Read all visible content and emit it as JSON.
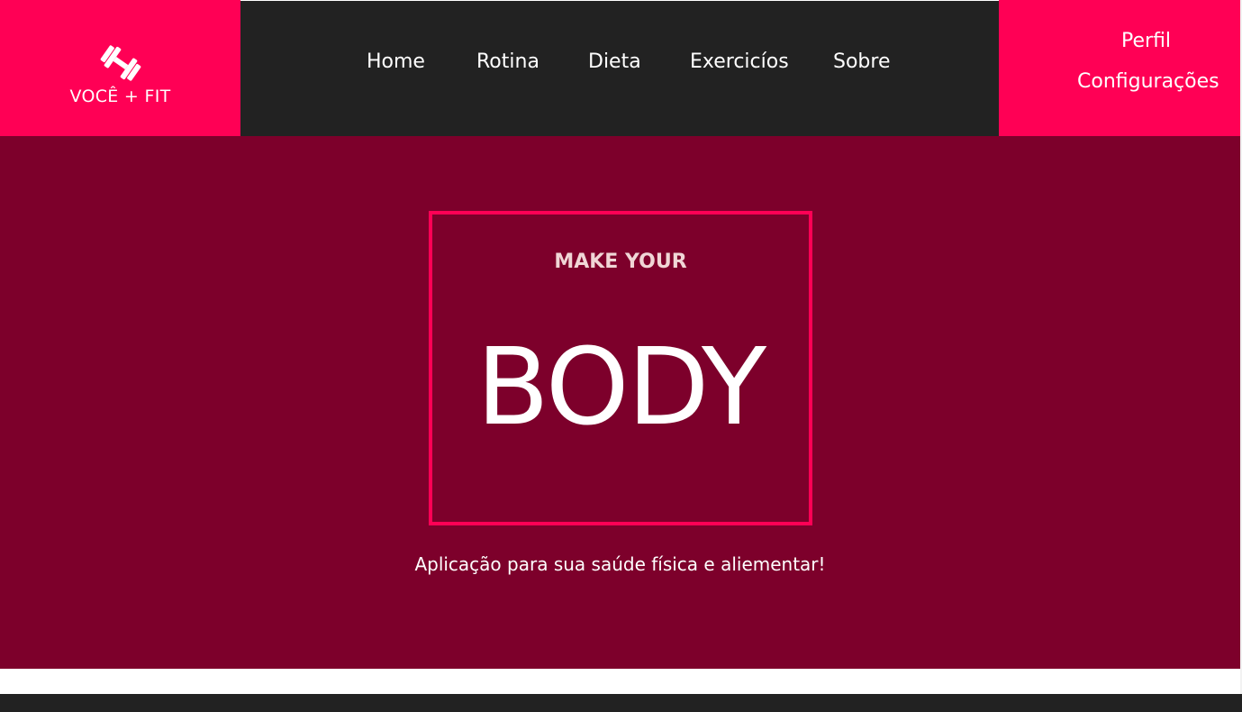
{
  "brand": {
    "name": "VOCÊ + FIT",
    "icon": "dumbbell-icon"
  },
  "nav": {
    "items": [
      {
        "label": "Home"
      },
      {
        "label": "Rotina"
      },
      {
        "label": "Dieta"
      },
      {
        "label": "Exercicíos"
      },
      {
        "label": "Sobre"
      }
    ]
  },
  "user_menu": {
    "profile": "Perfil",
    "settings": "Configurações"
  },
  "hero": {
    "kicker": "MAKE YOUR",
    "title": "BODY",
    "tagline": "Aplicação para sua saúde física e aliementar!"
  },
  "colors": {
    "accent": "#ff0055",
    "hero_background": "#7d002b",
    "nav_background": "#222222",
    "text": "#ffffff"
  }
}
